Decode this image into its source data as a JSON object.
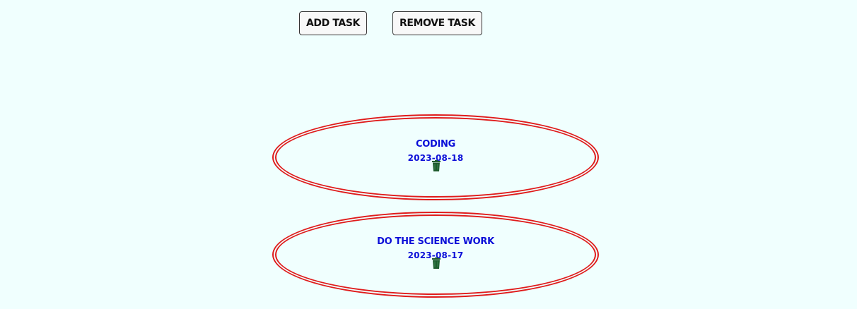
{
  "toolbar": {
    "add_label": "ADD TASK",
    "remove_label": "REMOVE TASK"
  },
  "tasks": [
    {
      "title": "CODING",
      "date": "2023-08-18",
      "delete_icon": "trash-icon"
    },
    {
      "title": "DO THE SCIENCE WORK",
      "date": "2023-08-17",
      "delete_icon": "trash-icon"
    }
  ],
  "colors": {
    "background": "#f0fffe",
    "task_border": "#e01b1b",
    "task_text": "#0c10d8",
    "trash": "#1f5c2e"
  }
}
